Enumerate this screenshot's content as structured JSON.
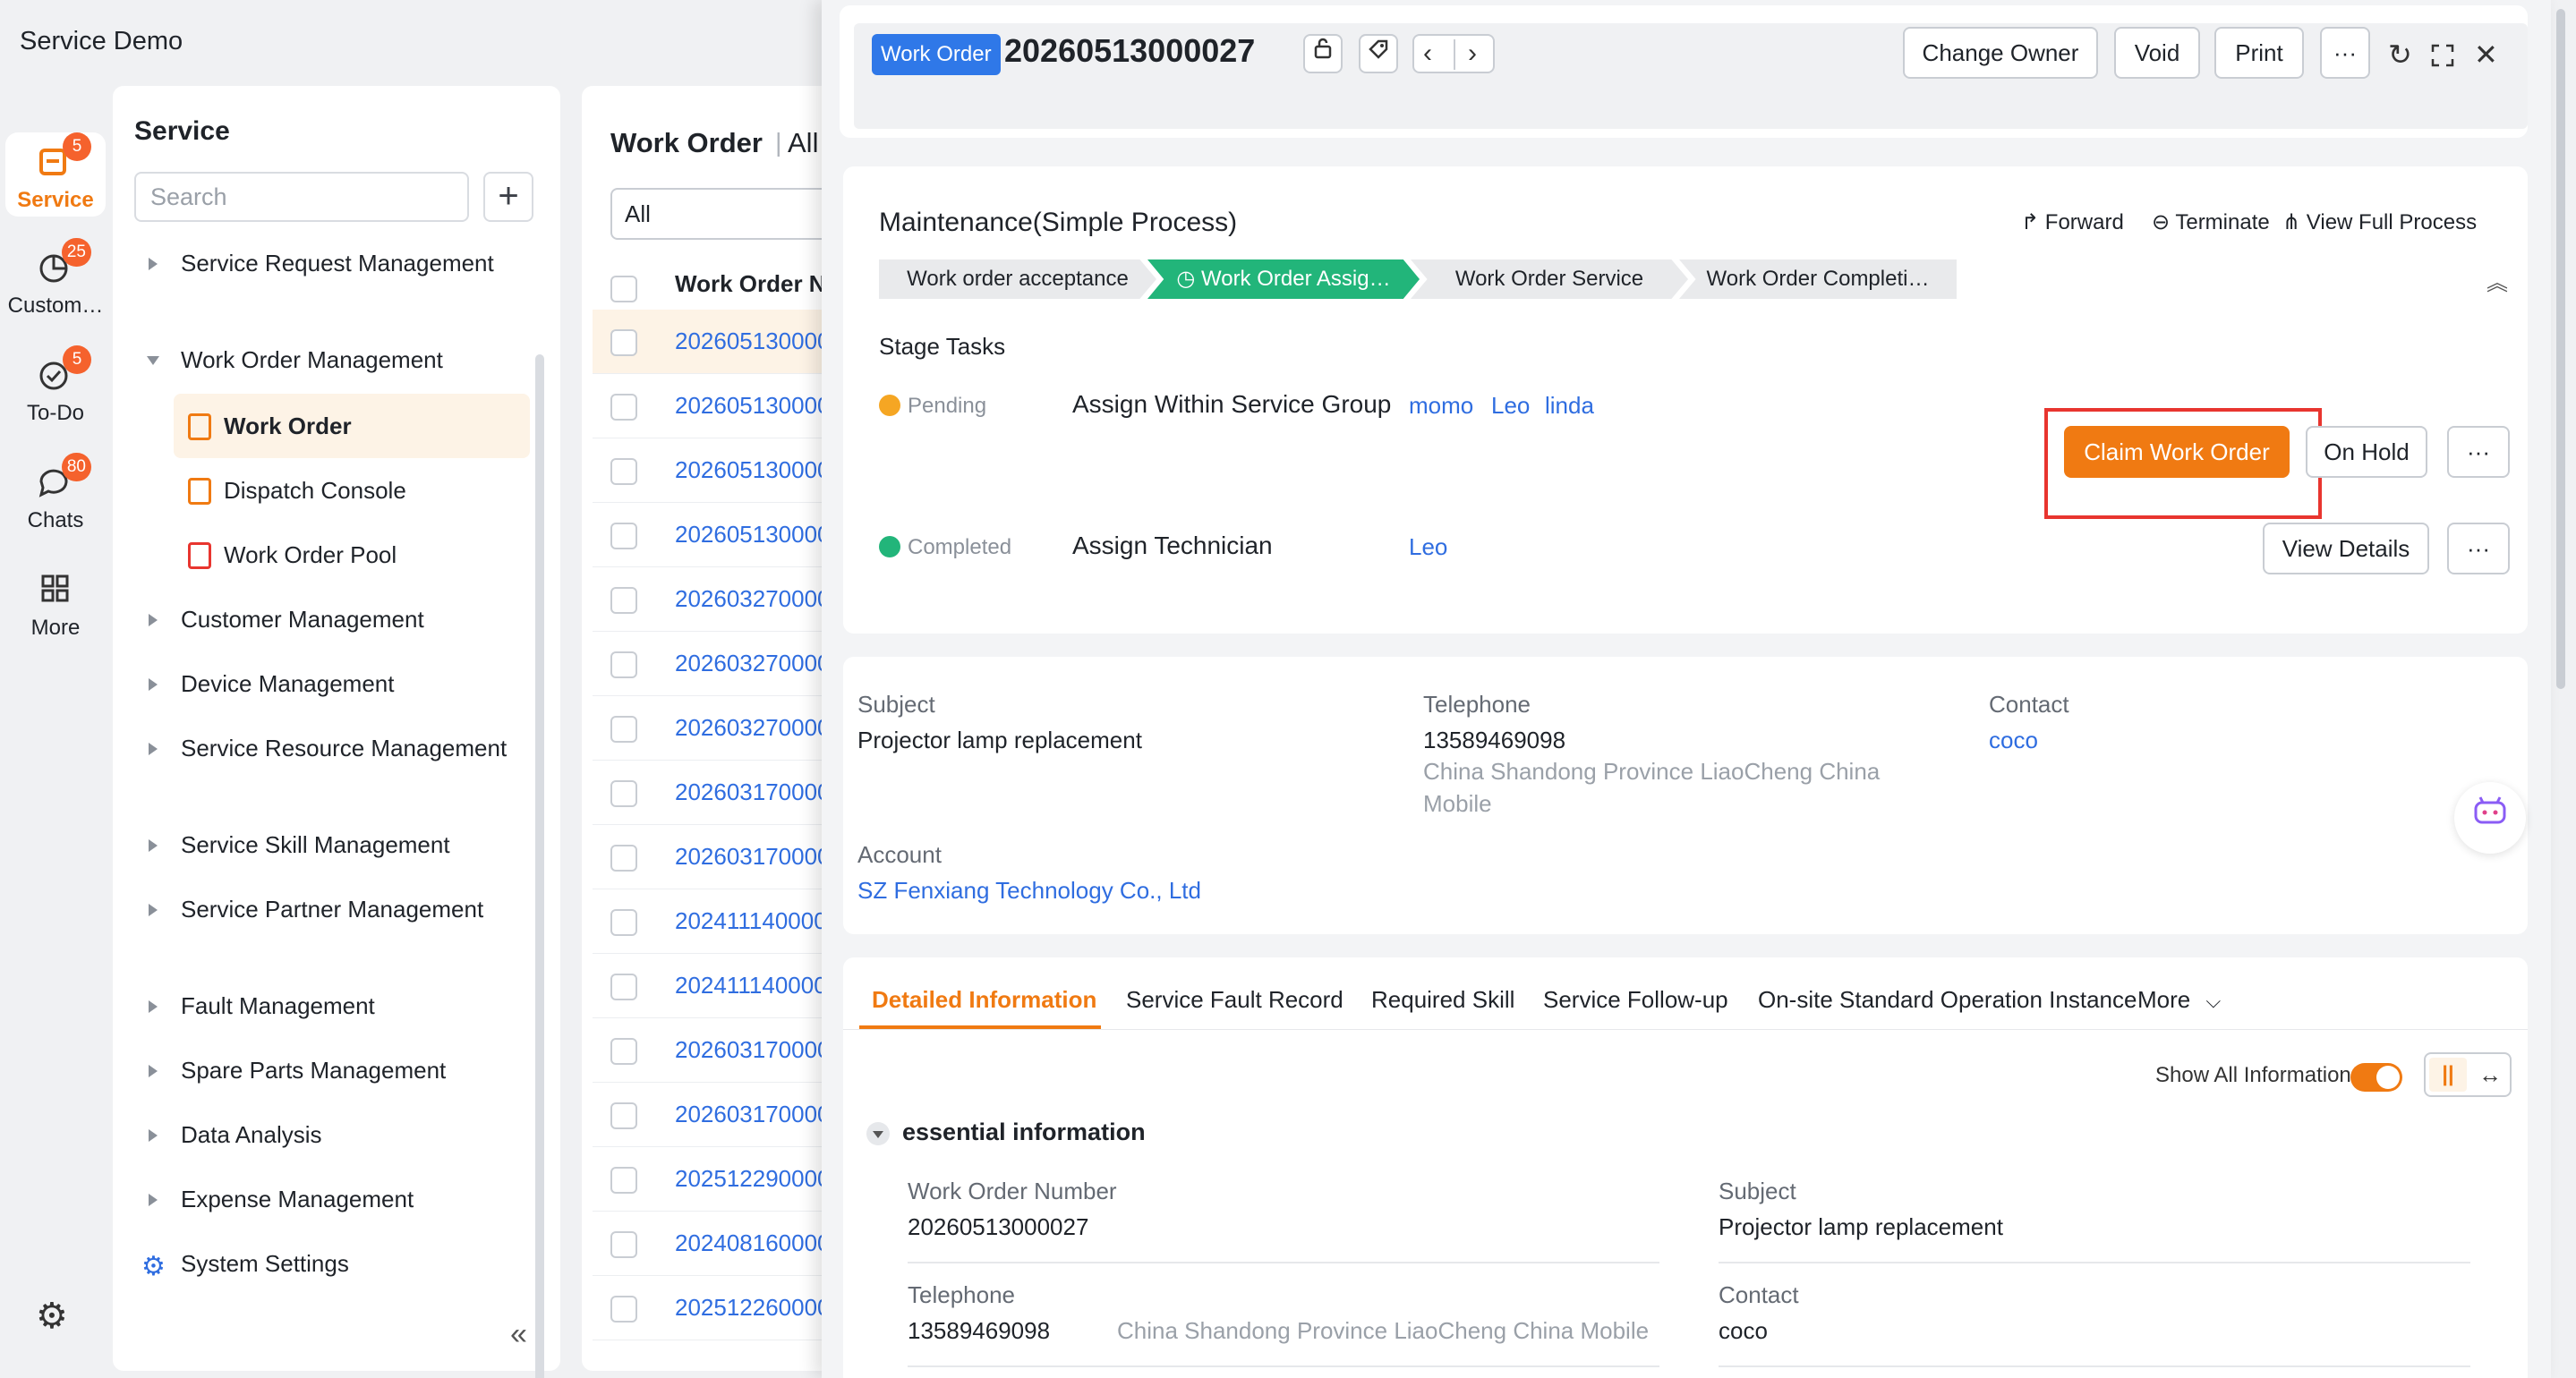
{
  "app": {
    "title": "Service Demo"
  },
  "rail": {
    "items": [
      {
        "label": "Service",
        "badge": "5",
        "icon": "service-icon"
      },
      {
        "label": "Custom…",
        "badge": "25",
        "icon": "customer-icon"
      },
      {
        "label": "To-Do",
        "badge": "5",
        "icon": "todo-icon"
      },
      {
        "label": "Chats",
        "badge": "80",
        "icon": "chat-icon"
      },
      {
        "label": "More",
        "badge": "",
        "icon": "grid-icon"
      }
    ],
    "settings_icon": "⚙"
  },
  "nav": {
    "title": "Service",
    "search_placeholder": "Search",
    "add": "+",
    "collapse": "«",
    "items": [
      {
        "label": "Service Request Management"
      },
      {
        "label": "Work Order Management"
      },
      {
        "label": "Customer Management"
      },
      {
        "label": "Device Management"
      },
      {
        "label": "Service Resource Management"
      },
      {
        "label": "Service Skill Management"
      },
      {
        "label": "Service Partner Management"
      },
      {
        "label": "Fault Management"
      },
      {
        "label": "Spare Parts Management"
      },
      {
        "label": "Data Analysis"
      },
      {
        "label": "Expense Management"
      },
      {
        "label": "System Settings"
      }
    ],
    "sub_items": [
      {
        "label": "Work Order"
      },
      {
        "label": "Dispatch Console"
      },
      {
        "label": "Work Order Pool"
      }
    ]
  },
  "list": {
    "title": "Work Order",
    "title_separator": "|",
    "view": "All",
    "filter_value": "All",
    "column_header": "Work Order N",
    "rows": [
      "202605130000",
      "202605130000",
      "202605130000",
      "202605130000",
      "202603270000",
      "202603270000",
      "202603270000",
      "202603170000",
      "202603170000",
      "202411140000",
      "202411140000",
      "202603170000",
      "202603170000",
      "202512290000",
      "202408160000",
      "202512260000"
    ]
  },
  "header": {
    "tag": "Work Order",
    "number": "20260513000027",
    "buttons": {
      "change_owner": "Change Owner",
      "void": "Void",
      "print": "Print",
      "more": "···"
    },
    "icons": {
      "refresh": "↻",
      "fullscreen": "⛶",
      "close": "✕",
      "prev": "‹",
      "next": "›",
      "lock": "🔓",
      "tag": "◇"
    }
  },
  "process": {
    "name": "Maintenance(Simple Process)",
    "actions": {
      "forward": "Forward",
      "terminate": "Terminate",
      "view_full": "View Full Process"
    },
    "stages": [
      {
        "label": "Work order acceptance",
        "active": false
      },
      {
        "label": "Work Order Assig…",
        "active": true
      },
      {
        "label": "Work Order Service",
        "active": false
      },
      {
        "label": "Work Order Completi…",
        "active": false
      }
    ],
    "collapse": "︽",
    "stage_tasks_title": "Stage Tasks",
    "tasks": [
      {
        "status": "Pending",
        "name": "Assign Within Service Group",
        "users": [
          "momo",
          "Leo",
          "linda"
        ],
        "primary_button": "Claim Work Order",
        "secondary_button": "On Hold",
        "more": "···"
      },
      {
        "status": "Completed",
        "name": "Assign Technician",
        "users": [
          "Leo"
        ],
        "secondary_button": "View Details",
        "more": "···"
      }
    ]
  },
  "summary": {
    "subject_label": "Subject",
    "subject": "Projector lamp replacement",
    "telephone_label": "Telephone",
    "telephone": "13589469098",
    "telephone_location_line1": "China Shandong Province LiaoCheng China",
    "telephone_location_line2": "Mobile",
    "contact_label": "Contact",
    "contact": "coco",
    "account_label": "Account",
    "account": "SZ Fenxiang Technology Co., Ltd"
  },
  "detail": {
    "tabs": [
      "Detailed Information",
      "Service Fault Record",
      "Required Skill",
      "Service Follow-up",
      "On-site Standard Operation Instance",
      "More"
    ],
    "show_all_label": "Show All Information",
    "layout_icons": {
      "columns": "||",
      "expand": "↔"
    },
    "section_title": "essential information",
    "fields": {
      "wo_number_label": "Work Order Number",
      "wo_number": "20260513000027",
      "subject_label": "Subject",
      "subject": "Projector lamp replacement",
      "telephone_label": "Telephone",
      "telephone": "13589469098",
      "telephone_location": "China Shandong Province LiaoCheng China Mobile",
      "contact_label": "Contact",
      "contact": "coco"
    }
  },
  "colors": {
    "accent": "#f07a12",
    "link": "#2f6de0",
    "stage_active": "#22b57a",
    "highlight_box": "#e8352f",
    "tag_blue": "#2f78e8"
  }
}
